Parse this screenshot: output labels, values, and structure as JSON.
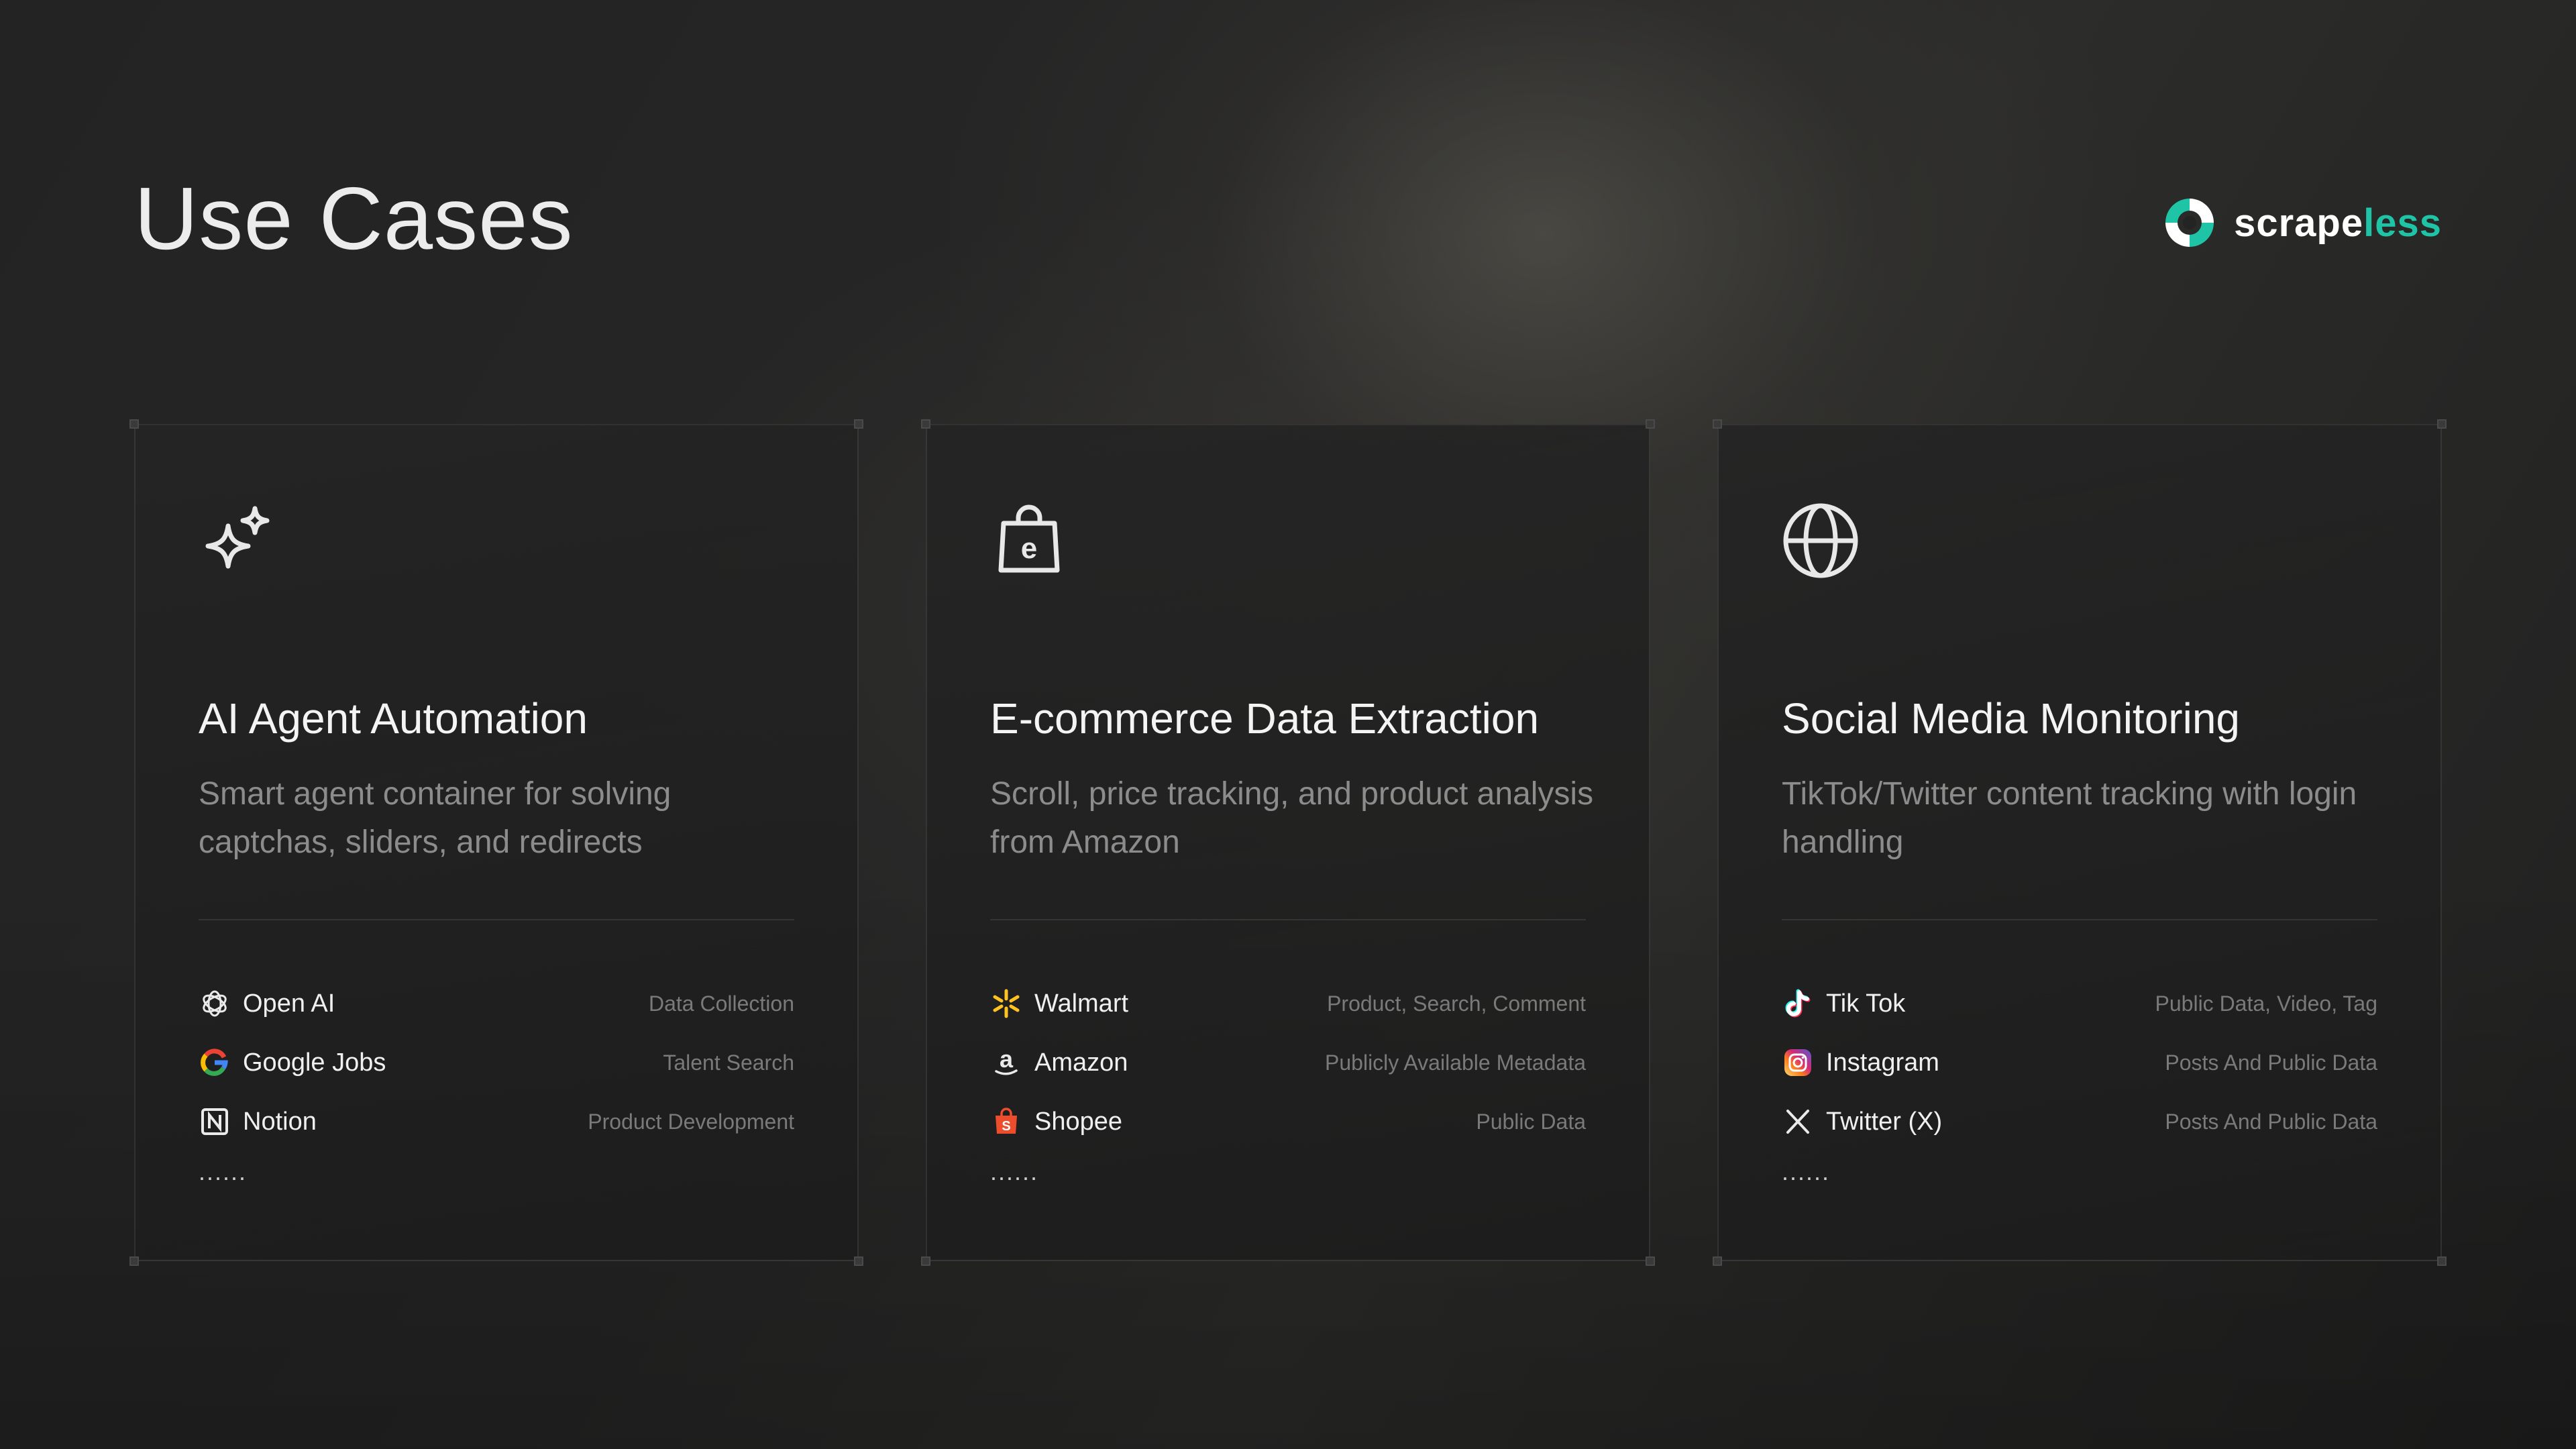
{
  "page": {
    "title": "Use Cases"
  },
  "logo": {
    "text_part1": "scrape",
    "text_part2": "less",
    "accent_color": "#1fc4a7"
  },
  "cards": [
    {
      "icon": "sparkles-icon",
      "title": "AI Agent Automation",
      "description": "Smart agent container for solving captchas, sliders, and redirects",
      "items": [
        {
          "icon": "openai-icon",
          "name": "Open AI",
          "tag": "Data Collection"
        },
        {
          "icon": "google-icon",
          "name": "Google Jobs",
          "tag": "Talent Search"
        },
        {
          "icon": "notion-icon",
          "name": "Notion",
          "tag": "Product Development"
        }
      ],
      "more": "......"
    },
    {
      "icon": "shopping-bag-icon",
      "title": "E-commerce Data Extraction",
      "description": "Scroll, price tracking, and product analysis from Amazon",
      "items": [
        {
          "icon": "walmart-icon",
          "name": "Walmart",
          "tag": "Product, Search, Comment"
        },
        {
          "icon": "amazon-icon",
          "name": "Amazon",
          "tag": "Publicly Available Metadata"
        },
        {
          "icon": "shopee-icon",
          "name": "Shopee",
          "tag": "Public Data"
        }
      ],
      "more": "......"
    },
    {
      "icon": "globe-icon",
      "title": "Social Media Monitoring",
      "description": "TikTok/Twitter content tracking with login handling",
      "items": [
        {
          "icon": "tiktok-icon",
          "name": "Tik Tok",
          "tag": "Public Data, Video, Tag"
        },
        {
          "icon": "instagram-icon",
          "name": "Instagram",
          "tag": "Posts And Public Data"
        },
        {
          "icon": "x-twitter-icon",
          "name": "Twitter (X)",
          "tag": "Posts And Public Data"
        }
      ],
      "more": "......"
    }
  ]
}
